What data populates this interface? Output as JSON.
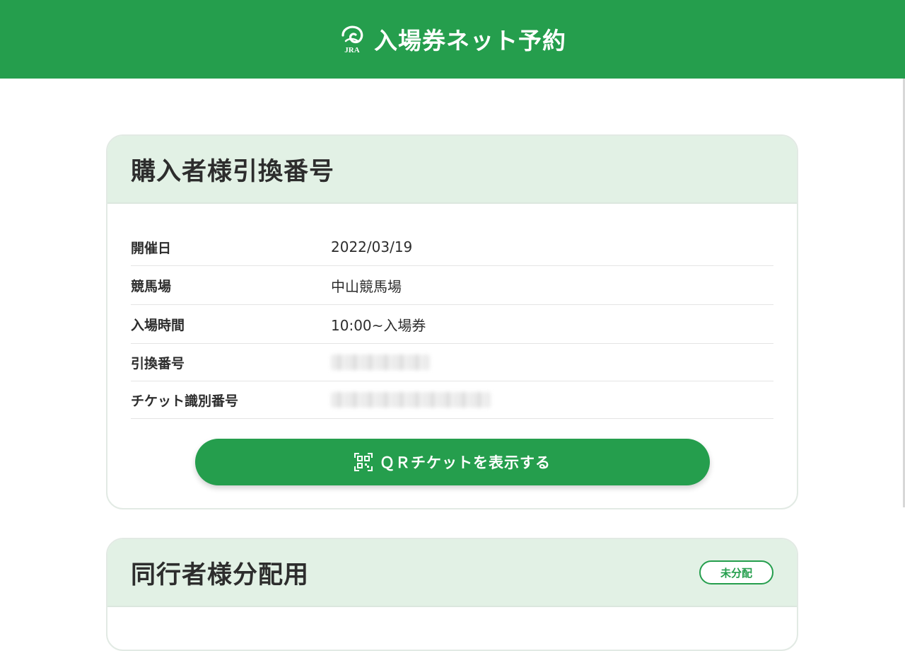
{
  "header": {
    "logo_text": "JRA",
    "title": "入場券ネット予約"
  },
  "purchaser_card": {
    "title": "購入者様引換番号",
    "rows": [
      {
        "label": "開催日",
        "value": "2022/03/19"
      },
      {
        "label": "競馬場",
        "value": "中山競馬場"
      },
      {
        "label": "入場時間",
        "value": "10:00~入場券"
      },
      {
        "label": "引換番号",
        "value": ""
      },
      {
        "label": "チケット識別番号",
        "value": ""
      }
    ],
    "qr_button_label": "ＱＲチケットを表示する",
    "qr_icon": "qr-code-icon"
  },
  "companion_card": {
    "title": "同行者様分配用",
    "status_badge": "未分配"
  },
  "colors": {
    "brand_green": "#259e4d",
    "card_header_bg": "#e2f1e5"
  }
}
